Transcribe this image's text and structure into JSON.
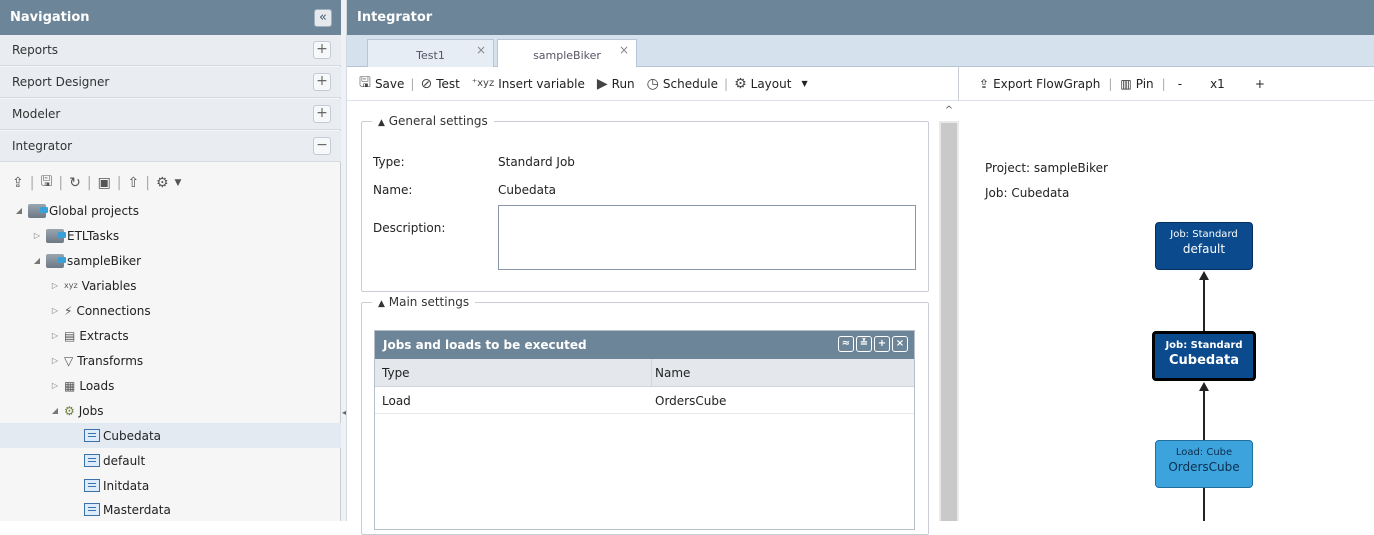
{
  "navigation": {
    "title": "Navigation",
    "collapse_icon": "«",
    "sections": [
      {
        "label": "Reports",
        "toggle": "+"
      },
      {
        "label": "Report Designer",
        "toggle": "+"
      },
      {
        "label": "Modeler",
        "toggle": "+"
      },
      {
        "label": "Integrator",
        "toggle": "−"
      }
    ],
    "tree": [
      {
        "label": "Global projects",
        "expander": "◢",
        "icon": "projects-folder-icon"
      },
      {
        "label": "ETLTasks",
        "expander": "▷",
        "icon": "project-icon"
      },
      {
        "label": "sampleBiker",
        "expander": "◢",
        "icon": "project-icon"
      },
      {
        "label": "Variables",
        "expander": "▷",
        "icon": "variables-icon",
        "glyph": "xyz"
      },
      {
        "label": "Connections",
        "expander": "▷",
        "icon": "connections-icon",
        "glyph": "⚡"
      },
      {
        "label": "Extracts",
        "expander": "▷",
        "icon": "extracts-icon",
        "glyph": "▤"
      },
      {
        "label": "Transforms",
        "expander": "▷",
        "icon": "transforms-icon",
        "glyph": "▽"
      },
      {
        "label": "Loads",
        "expander": "▷",
        "icon": "loads-icon",
        "glyph": "▦"
      },
      {
        "label": "Jobs",
        "expander": "◢",
        "icon": "jobs-icon",
        "glyph": "⚙"
      },
      {
        "label": "Cubedata",
        "expander": "",
        "icon": "job-icon"
      },
      {
        "label": "default",
        "expander": "",
        "icon": "job-icon"
      },
      {
        "label": "Initdata",
        "expander": "",
        "icon": "job-icon"
      },
      {
        "label": "Masterdata",
        "expander": "",
        "icon": "job-icon"
      }
    ]
  },
  "integrator": {
    "title": "Integrator",
    "tabs": [
      {
        "label": "Test1",
        "close": "×"
      },
      {
        "label": "sampleBiker",
        "close": "×"
      }
    ]
  },
  "editor_toolbar": {
    "save": "Save",
    "test": "Test",
    "insert_variable": "Insert variable",
    "run": "Run",
    "schedule": "Schedule",
    "layout": "Layout"
  },
  "general_settings": {
    "legend": "General settings",
    "type_label": "Type:",
    "type_value": "Standard Job",
    "name_label": "Name:",
    "name_value": "Cubedata",
    "description_label": "Description:",
    "description_value": ""
  },
  "main_settings": {
    "legend": "Main settings",
    "grid_title": "Jobs and loads to be executed",
    "columns": [
      "Type",
      "Name"
    ],
    "rows": [
      {
        "type": "Load",
        "name": "OrdersCube"
      }
    ]
  },
  "flow_toolbar": {
    "export": "Export FlowGraph",
    "pin": "Pin",
    "zoom_out": "-",
    "zoom": "x1",
    "zoom_in": "+"
  },
  "flow_graph": {
    "project": "Project: sampleBiker",
    "job": "Job: Cubedata",
    "nodes": [
      {
        "type": "Job: Standard",
        "name": "default",
        "color": "#0b4a8c"
      },
      {
        "type": "Job: Standard",
        "name": "Cubedata",
        "color": "#0b4a8c"
      },
      {
        "type": "Load: Cube",
        "name": "OrdersCube",
        "color": "#3ca3dd"
      }
    ]
  }
}
